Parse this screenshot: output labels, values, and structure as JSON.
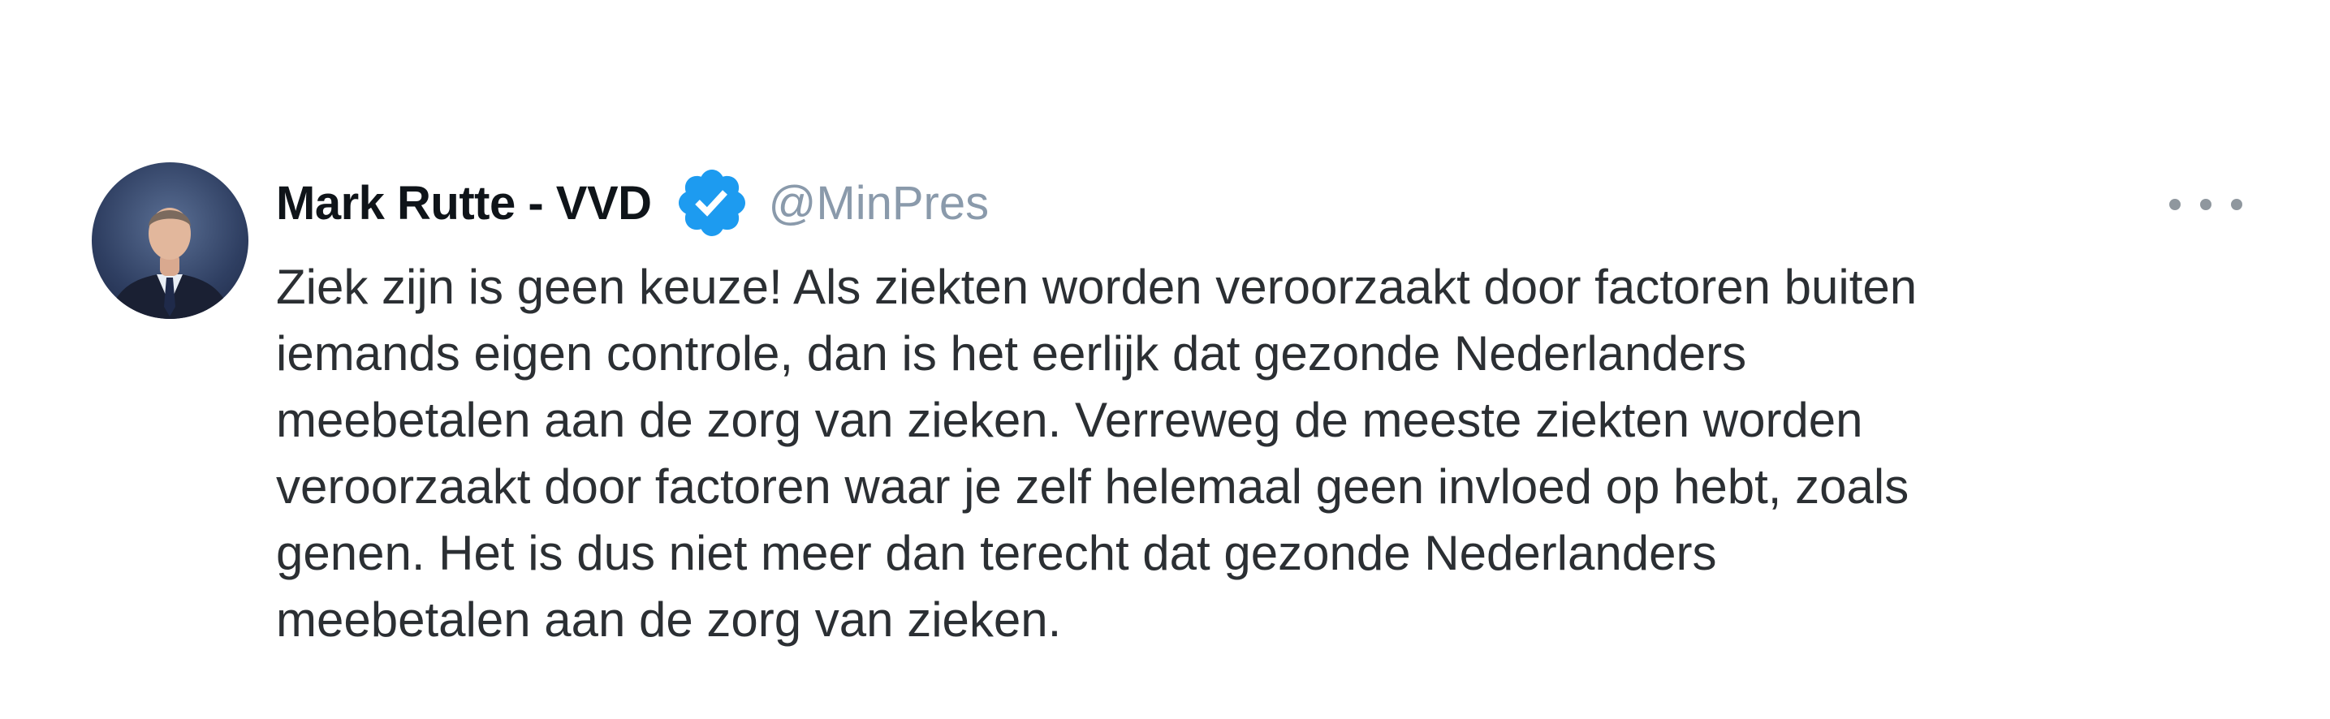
{
  "author": {
    "display_name": "Mark Rutte - VVD",
    "handle": "@MinPres",
    "verified": true,
    "verified_badge_color": "#1d9bf0"
  },
  "tweet": {
    "lines": [
      "Ziek zijn is geen keuze! Als ziekten worden veroorzaakt door factoren buiten",
      "iemands eigen controle, dan is het eerlijk dat gezonde Nederlanders",
      "meebetalen aan de zorg van zieken. Verreweg de meeste ziekten worden",
      "veroorzaakt door factoren waar je zelf helemaal geen invloed op hebt, zoals",
      "genen. Het is dus niet meer dan terecht dat gezonde Nederlanders",
      "meebetalen aan de zorg van zieken."
    ]
  },
  "icons": {
    "verified": "verified-badge-icon",
    "more": "more-horizontal-icon"
  }
}
